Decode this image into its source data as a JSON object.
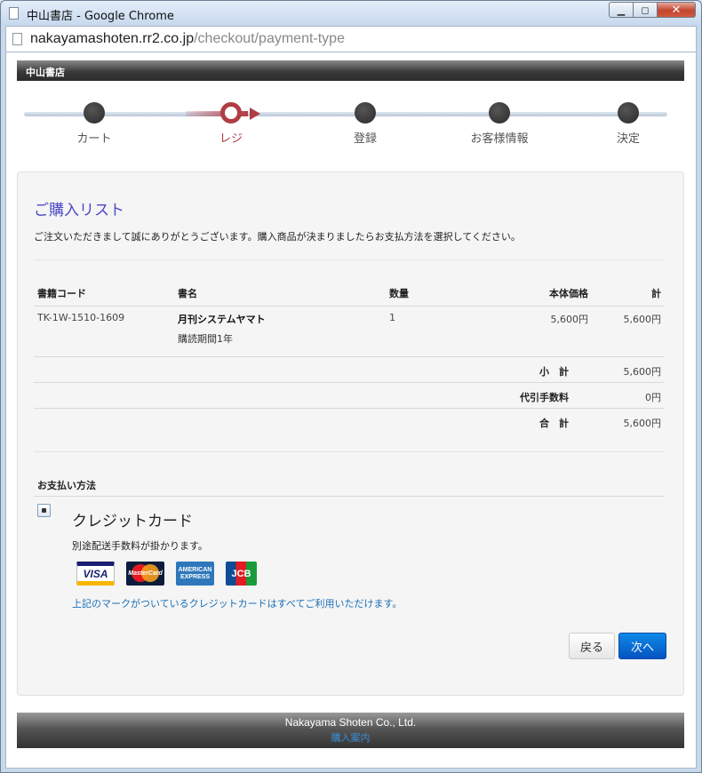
{
  "browser": {
    "window_title": "中山書店 - Google Chrome",
    "url_host": "nakayamashoten.rr2.co.jp",
    "url_path": "/checkout/payment-type"
  },
  "site": {
    "header_title": "中山書店",
    "footer_company": "Nakayama Shoten Co., Ltd.",
    "footer_link": "購入案内"
  },
  "steps": [
    {
      "label": "カート",
      "active": false
    },
    {
      "label": "レジ",
      "active": true
    },
    {
      "label": "登録",
      "active": false
    },
    {
      "label": "お客様情報",
      "active": false
    },
    {
      "label": "決定",
      "active": false
    }
  ],
  "order": {
    "title": "ご購入リスト",
    "lead": "ご注文いただきまして誠にありがとうございます。購入商品が決まりましたらお支払方法を選択してください。",
    "columns": {
      "code": "書籍コード",
      "name": "書名",
      "qty": "数量",
      "unit_price": "本体価格",
      "total": "計"
    },
    "items": [
      {
        "code": "TK-1W-1510-1609",
        "name": "月刊システムヤマト",
        "subtitle": "購読期間1年",
        "qty": "1",
        "unit_price": "5,600円",
        "total": "5,600円"
      }
    ],
    "summary": [
      {
        "label": "小　計",
        "value": "5,600円"
      },
      {
        "label": "代引手数料",
        "value": "0円"
      },
      {
        "label": "合　計",
        "value": "5,600円"
      }
    ]
  },
  "payment": {
    "heading": "お支払い方法",
    "method_name": "クレジットカード",
    "selected": true,
    "note": "別途配送手数料が掛かります。",
    "cards": [
      "VISA",
      "MasterCard",
      "AMERICAN EXPRESS",
      "JCB"
    ],
    "info_link": "上記のマークがついているクレジットカードはすべてご利用いただけます。"
  },
  "buttons": {
    "back": "戻る",
    "next": "次へ"
  }
}
